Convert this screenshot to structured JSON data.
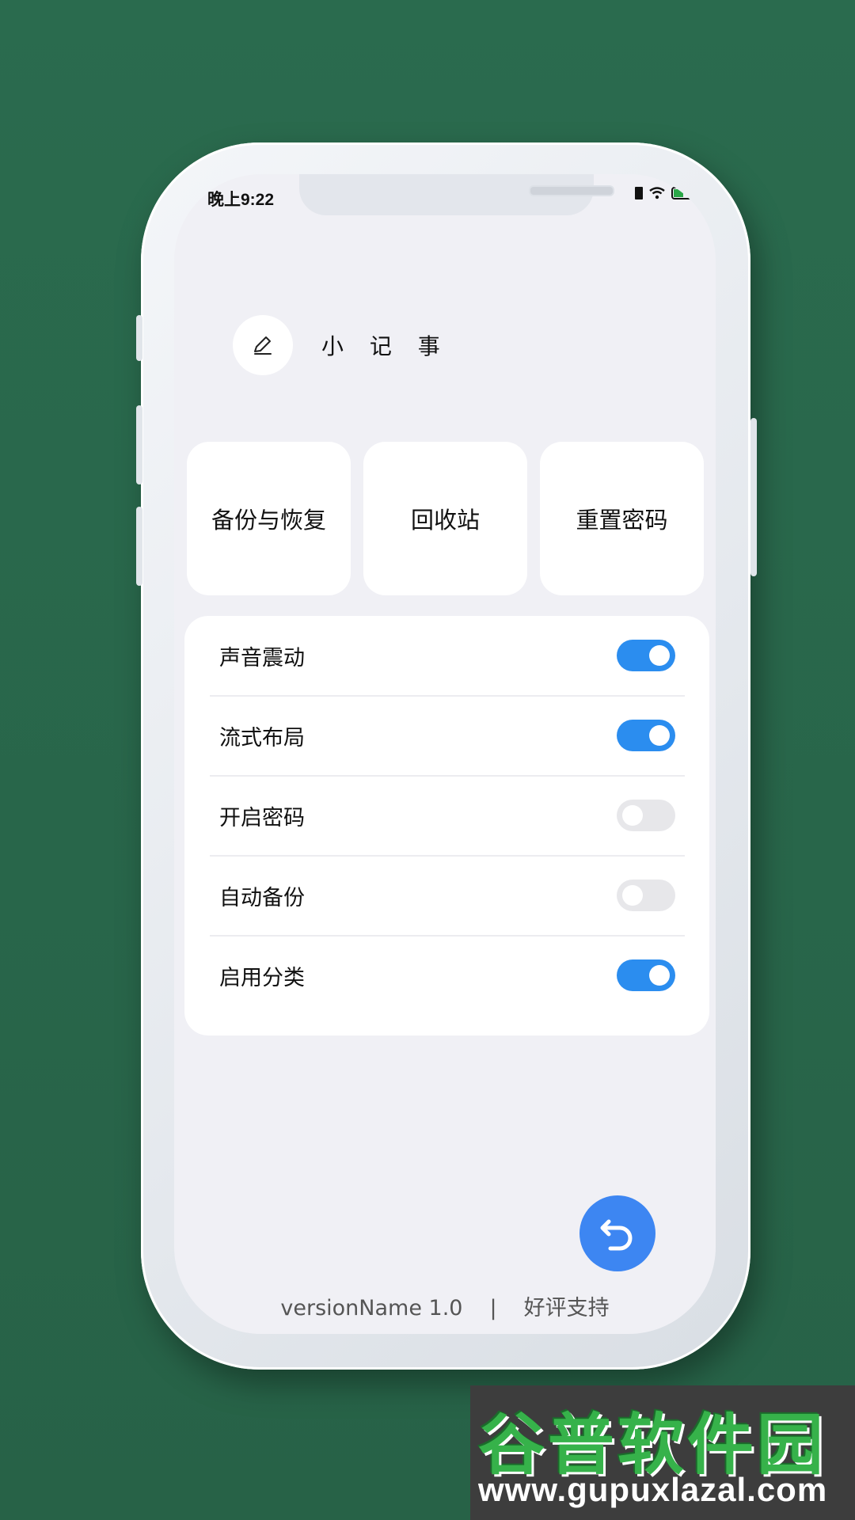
{
  "status_bar": {
    "time": "晚上9:22"
  },
  "app": {
    "title": "小 记 事",
    "icon": "pen-icon"
  },
  "actions": [
    {
      "label": "备份与恢复"
    },
    {
      "label": "回收站"
    },
    {
      "label": "重置密码"
    }
  ],
  "settings": [
    {
      "label": "声音震动",
      "enabled": true
    },
    {
      "label": "流式布局",
      "enabled": true
    },
    {
      "label": "开启密码",
      "enabled": false
    },
    {
      "label": "自动备份",
      "enabled": false
    },
    {
      "label": "启用分类",
      "enabled": true
    }
  ],
  "fab": {
    "icon": "back-arrow-icon"
  },
  "footer": {
    "version": "versionName 1.0",
    "separator": "|",
    "review_link": "好评支持"
  },
  "watermark": {
    "title": "谷普软件园",
    "url": "www.gupuxlazal.com"
  },
  "colors": {
    "background": "#2a6b4e",
    "toggle_on": "#2b8def",
    "toggle_off": "#e7e7ea",
    "fab": "#3d86f2"
  }
}
